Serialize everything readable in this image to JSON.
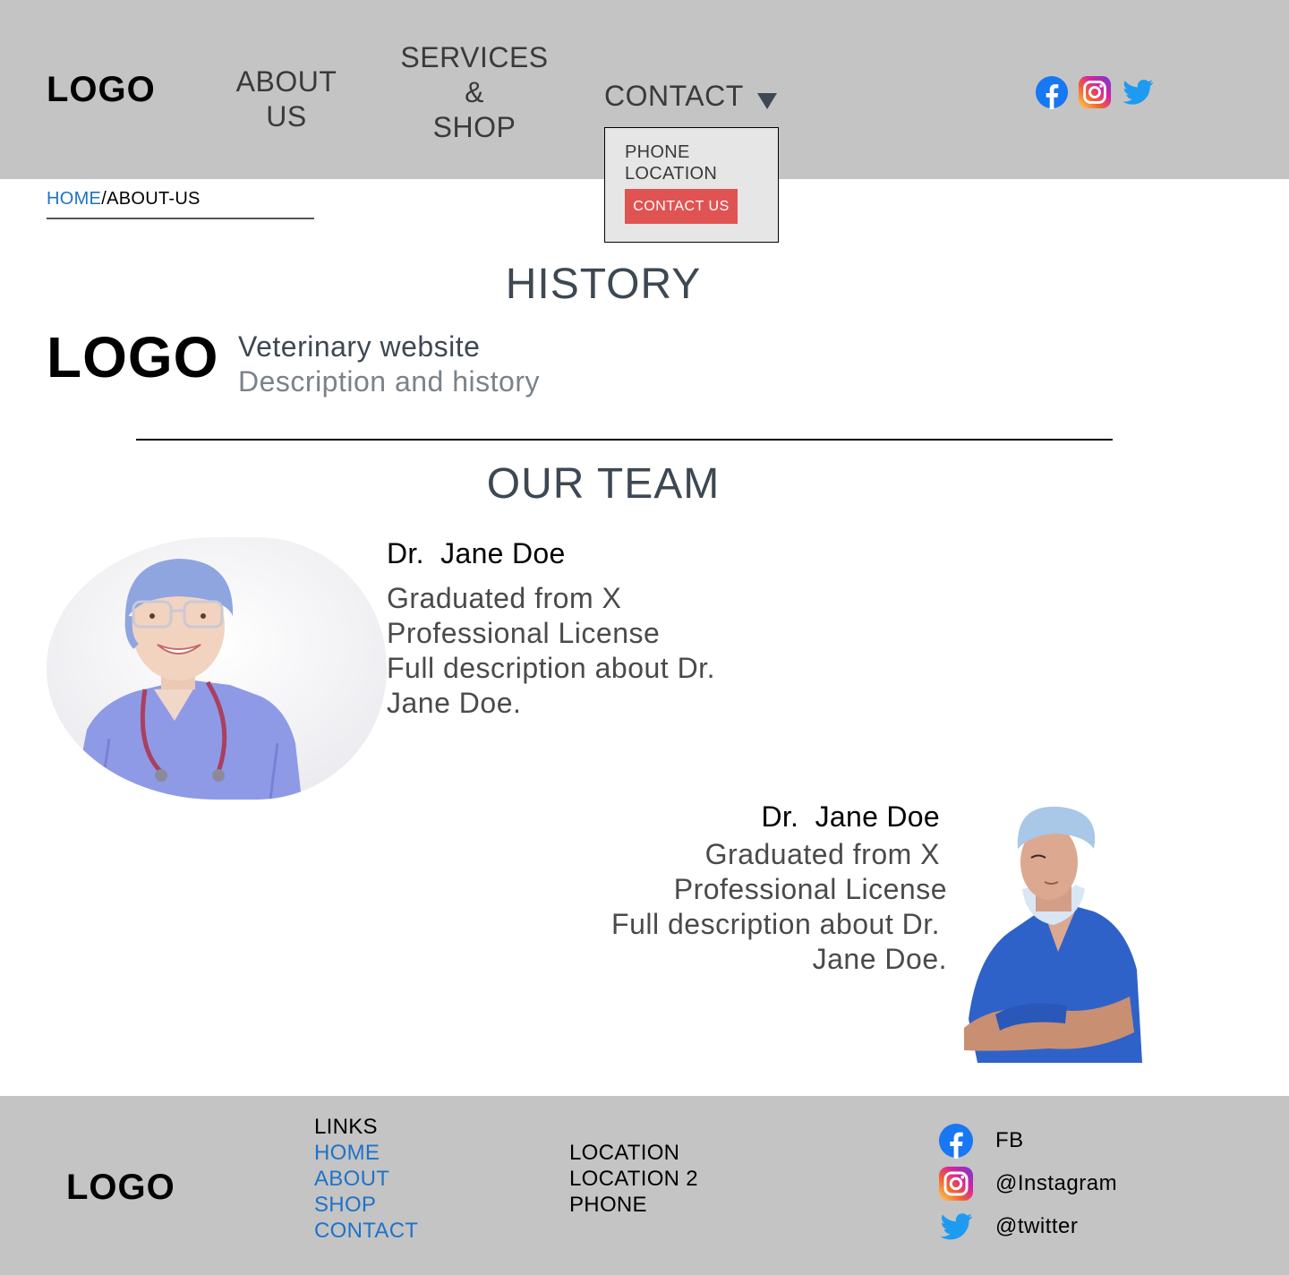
{
  "header": {
    "logo": "LOGO",
    "nav": {
      "about_line1": "ABOUT",
      "about_line2": "US",
      "services_line1": "SERVICES",
      "services_line2": "&",
      "services_line3": "SHOP",
      "contact": "CONTACT"
    },
    "social_icons": [
      "facebook-icon",
      "instagram-icon",
      "twitter-icon"
    ]
  },
  "dropdown": {
    "phone": "PHONE",
    "location": "LOCATION",
    "button": "CONTACT US"
  },
  "breadcrumb": {
    "home": "HOME",
    "separator": "/",
    "current": "ABOUT-US"
  },
  "history": {
    "title": "HISTORY",
    "logo": "LOGO",
    "name": "Veterinary website",
    "description": "Description and history"
  },
  "team": {
    "title": "OUR TEAM",
    "members": [
      {
        "name": "Dr.  Jane Doe",
        "lines": [
          "Graduated from X",
          "Professional License",
          "Full description about Dr.",
          "Jane Doe."
        ]
      },
      {
        "name": "Dr.  Jane Doe",
        "lines": [
          "Graduated from X",
          "Professional License",
          "Full description about Dr.",
          "Jane Doe."
        ]
      }
    ]
  },
  "footer": {
    "logo": "LOGO",
    "links_label": "LINKS",
    "links": [
      "HOME",
      "ABOUT",
      "SHOP",
      "CONTACT"
    ],
    "locations": [
      "LOCATION",
      "LOCATION 2",
      "PHONE"
    ],
    "social": [
      {
        "icon": "facebook-icon",
        "label": "FB"
      },
      {
        "icon": "instagram-icon",
        "label": "@Instagram"
      },
      {
        "icon": "twitter-icon",
        "label": "@twitter"
      }
    ]
  },
  "colors": {
    "header_bg": "#c4c4c4",
    "link_blue": "#1e73c8",
    "button_red": "#e05353",
    "facebook": "#1877f2",
    "twitter": "#1d9bf0"
  }
}
